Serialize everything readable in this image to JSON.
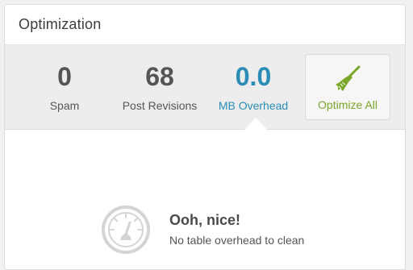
{
  "panel": {
    "title": "Optimization"
  },
  "stats": [
    {
      "value": "0",
      "label": "Spam"
    },
    {
      "value": "68",
      "label": "Post Revisions"
    },
    {
      "value": "0.0",
      "label": "MB Overhead"
    }
  ],
  "optimize_button": {
    "label": "Optimize All",
    "icon": "broom-icon",
    "color": "#7aa72a"
  },
  "empty_state": {
    "icon": "speedometer-icon",
    "title": "Ooh, nice!",
    "subtitle": "No table overhead to clean"
  },
  "colors": {
    "highlight": "#2a8cb7",
    "accent_green": "#7aa72a"
  }
}
